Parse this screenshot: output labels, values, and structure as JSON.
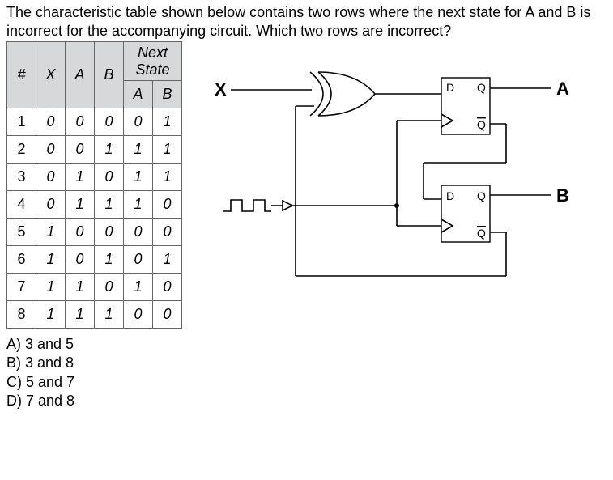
{
  "question": "The characteristic table shown below contains two rows where the next state for A and B is incorrect for the accompanying circuit. Which two rows are incorrect?",
  "headers": {
    "num": "#",
    "x": "X",
    "a": "A",
    "b": "B",
    "next": "Next State",
    "na": "A",
    "nb": "B"
  },
  "rows": [
    {
      "n": "1",
      "x": "0",
      "a": "0",
      "b": "0",
      "na": "0",
      "nb": "1"
    },
    {
      "n": "2",
      "x": "0",
      "a": "0",
      "b": "1",
      "na": "1",
      "nb": "1"
    },
    {
      "n": "3",
      "x": "0",
      "a": "1",
      "b": "0",
      "na": "1",
      "nb": "1"
    },
    {
      "n": "4",
      "x": "0",
      "a": "1",
      "b": "1",
      "na": "1",
      "nb": "0"
    },
    {
      "n": "5",
      "x": "1",
      "a": "0",
      "b": "0",
      "na": "0",
      "nb": "0"
    },
    {
      "n": "6",
      "x": "1",
      "a": "0",
      "b": "1",
      "na": "0",
      "nb": "1"
    },
    {
      "n": "7",
      "x": "1",
      "a": "1",
      "b": "0",
      "na": "1",
      "nb": "0"
    },
    {
      "n": "8",
      "x": "1",
      "a": "1",
      "b": "1",
      "na": "0",
      "nb": "0"
    }
  ],
  "labels": {
    "x": "X",
    "a": "A",
    "b": "B",
    "d": "D",
    "q": "Q",
    "qbar": "Q"
  },
  "options": {
    "a": "A) 3 and 5",
    "b": "B) 3 and 8",
    "c": "C) 5 and 7",
    "d": "D) 7 and 8"
  }
}
